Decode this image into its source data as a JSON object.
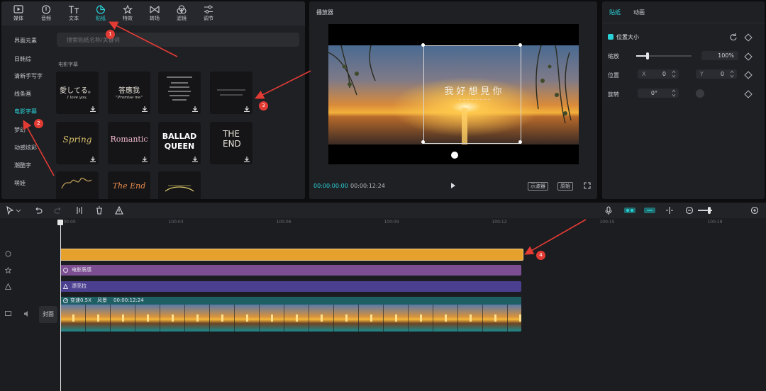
{
  "toolbar": {
    "tabs": [
      {
        "label": "媒体",
        "icon": "media-icon"
      },
      {
        "label": "音频",
        "icon": "audio-icon"
      },
      {
        "label": "文本",
        "icon": "text-icon"
      },
      {
        "label": "贴纸",
        "icon": "sticker-icon",
        "active": true
      },
      {
        "label": "特效",
        "icon": "effects-icon"
      },
      {
        "label": "转场",
        "icon": "transition-icon"
      },
      {
        "label": "滤镜",
        "icon": "filter-icon"
      },
      {
        "label": "调节",
        "icon": "adjust-icon"
      }
    ]
  },
  "sidebar": {
    "items": [
      {
        "label": "界面元素"
      },
      {
        "label": "日韩综"
      },
      {
        "label": "清新手写字"
      },
      {
        "label": "线条画"
      },
      {
        "label": "电影字幕",
        "active": true
      },
      {
        "label": "梦幻"
      },
      {
        "label": "动感炫彩"
      },
      {
        "label": "潮酷字"
      },
      {
        "label": "萌娃"
      }
    ]
  },
  "search": {
    "placeholder": "搜索贴纸名称/关键词"
  },
  "library": {
    "section_title": "电影字幕",
    "stickers": [
      {
        "main": "愛してる。",
        "sub": "I love you."
      },
      {
        "main": "答應我",
        "sub": "\"Promise me\""
      },
      {
        "main": "",
        "sub": ""
      },
      {
        "main": "",
        "sub": ""
      },
      {
        "main": "Spring",
        "sub": ""
      },
      {
        "main": "Romantic",
        "sub": ""
      },
      {
        "main": "BALLAD QUEEN",
        "sub": ""
      },
      {
        "main": "THE END",
        "sub": ""
      },
      {
        "main": "",
        "sub": ""
      },
      {
        "main": "The End",
        "sub": ""
      },
      {
        "main": "",
        "sub": ""
      }
    ]
  },
  "player": {
    "title": "播放器",
    "overlay_title": "我好想見你",
    "current_time": "00:00:00:00",
    "total_time": "00:00:12:24",
    "btn_guide": "示波器",
    "btn_original": "原始"
  },
  "props": {
    "tab_sticker": "贴纸",
    "tab_animation": "动画",
    "section": "位置大小",
    "scale_label": "缩放",
    "scale_value": "100%",
    "scale_level": 0.2,
    "position_label": "位置",
    "pos_x_prefix": "X",
    "pos_x": "0",
    "pos_y_prefix": "Y",
    "pos_y": "0",
    "rotate_label": "旋转",
    "rotate_value": "0°"
  },
  "timeline": {
    "ruler": [
      "00:00",
      "100:03",
      "100:06",
      "100:09",
      "100:12",
      "100:15",
      "100:18"
    ],
    "tracks": {
      "effect1_label": "电影质感",
      "effect2_label": "漂亮拉",
      "video_speed": "变速0.5X",
      "video_name": "风景",
      "video_duration": "00:00:12:24",
      "cover_label": "封面"
    }
  },
  "badges": [
    "1",
    "2",
    "3",
    "4"
  ],
  "colors": {
    "accent": "#29d3d8",
    "sticker_track": "#e6a02c",
    "effect_track": "#7c4f92",
    "filter_track": "#4b3f8f",
    "video_track": "#1f6f72",
    "badge": "#e23b34"
  }
}
